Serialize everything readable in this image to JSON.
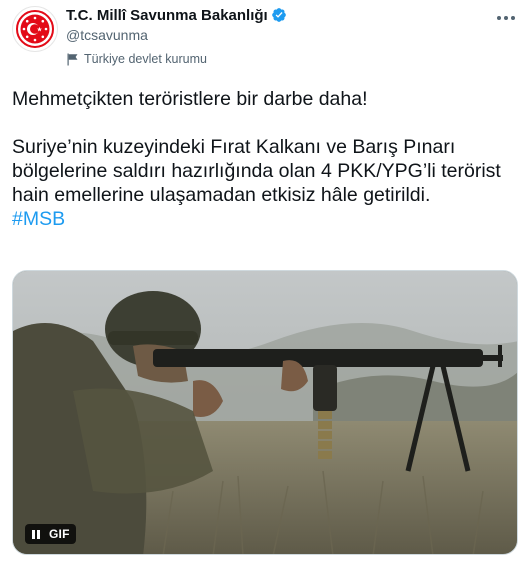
{
  "account": {
    "display_name": "T.C. Millî Savunma Bakanlığı",
    "handle": "@tcsavunma",
    "label": "Türkiye devlet kurumu",
    "verified_icon": "verified-badge-icon",
    "label_icon": "flag-icon",
    "avatar_icon": "ministry-emblem-icon"
  },
  "tweet": {
    "line1": "Mehmetçikten teröristlere bir darbe daha!",
    "body": "Suriye’nin kuzeyindeki Fırat Kalkanı ve Barış Pınarı bölgelerine saldırı hazırlığında olan 4 PKK/YPG’li terörist hain emellerine ulaşamadan etkisiz hâle getirildi.",
    "hashtag": "#MSB"
  },
  "media": {
    "type": "gif",
    "badge": "GIF",
    "pause_icon": "pause-icon"
  },
  "menu": {
    "icon": "more-options-icon"
  },
  "colors": {
    "accent": "#1d9bf0",
    "text": "#0f1419",
    "secondary": "#536471",
    "emblem_red": "#e30a17"
  }
}
